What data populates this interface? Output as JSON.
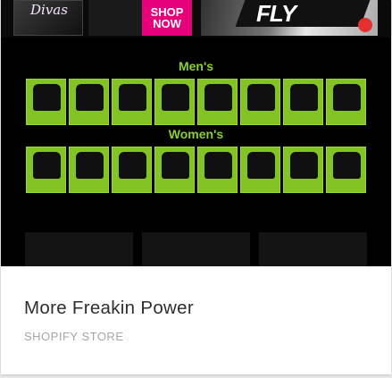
{
  "card": {
    "title": "More Freakin Power",
    "subtitle": "SHOPIFY STORE"
  },
  "banner": {
    "divas": "Divas",
    "shop_line1": "SHOP",
    "shop_line2": "NOW",
    "fly_logo": "FLY"
  },
  "sections": {
    "mens": "Men's",
    "womens": "Women's"
  },
  "colors": {
    "accent_green": "#83c425",
    "background": "#000000",
    "shop_pink": "#e6007a"
  }
}
